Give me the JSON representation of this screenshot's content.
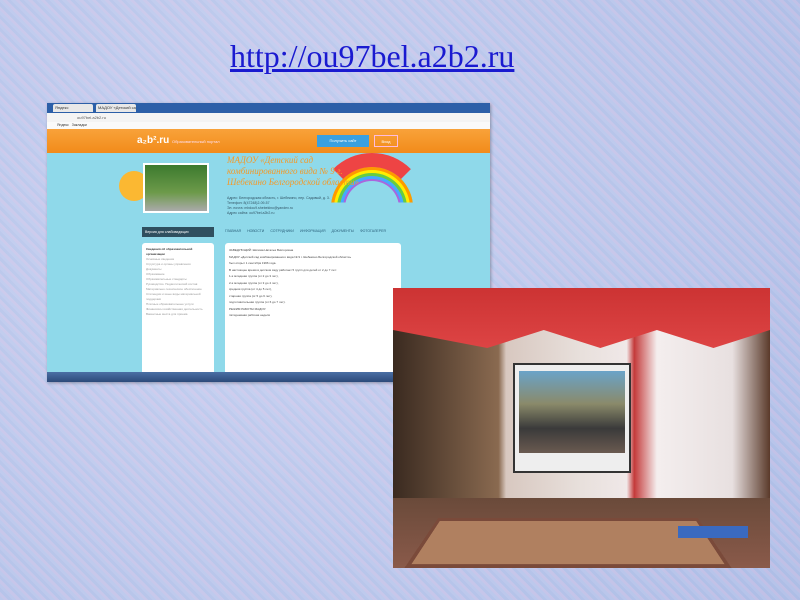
{
  "slide": {
    "title_link": "http://ou97bel.a2b2.ru"
  },
  "website_screenshot": {
    "browser_tabs": [
      "Яндекс",
      "МАДОУ «Детский сад к..."
    ],
    "address": "ou97bel.a2b2.ru",
    "bookmarks": [
      "Яндекс",
      "Закладки"
    ],
    "portal_logo": "a₂b².ru",
    "portal_tagline": "Образовательный портал",
    "get_site_button": "Получить сайт",
    "login_button": "Вход",
    "site_title": "МАДОУ «Детский сад комбинированного вида № 9 г. Шебекино Белгородской области»",
    "contacts": [
      "Адрес: Белгородская область, г. Шебекино, пер. Садовый, д. 3.",
      "Телефон: 8(47248)2-09-57",
      "Эл. почта: mbdou9.shebekino@yandex.ru",
      "Адрес сайта: ou97bel.a2b2.ru"
    ],
    "low_vision_button": "Версия для слабовидящих",
    "nav": [
      "ГЛАВНАЯ",
      "НОВОСТИ",
      "СОТРУДНИКИ",
      "ИНФОРМАЦИЯ",
      "ДОКУМЕНТЫ",
      "ФОТОГАЛЕРЕЯ"
    ],
    "sidebar_heading": "Сведения об образовательной организации",
    "sidebar_items": [
      "Основные сведения",
      "Структура и органы управления",
      "Документы",
      "Образование",
      "Образовательные стандарты",
      "Руководство. Педагогический состав",
      "Материально-техническое обеспечение",
      "Стипендии и иные виды материальной поддержки",
      "Платные образовательные услуги",
      "Финансово-хозяйственная деятельность",
      "Вакантные места для приема"
    ],
    "content_lines": [
      "ЗАВЕДУЮЩИЙ: Шипова Наталья Викторовна",
      "МАДОУ «Детский сад комбинированного вида № 9 г. Шебекино Белгородской области»",
      "был открыт 1 сентября 1966 года.",
      "В настоящее время в детском саду работает 5 групп для детей от 2 до 7 лет:",
      "1-я младшая группа (от 2 до 3 лет),",
      "2-я младшая группа (от 3 до 4 лет),",
      "средняя группа (от 4 до 5 лет),",
      "старшая группа (от 5 до 6 лет),",
      "подготовительная группа (от 6 до 7 лет).",
      "РЕЖИМ РАБОТЫ МАДОУ:",
      "пятидневная рабочая неделя"
    ]
  }
}
